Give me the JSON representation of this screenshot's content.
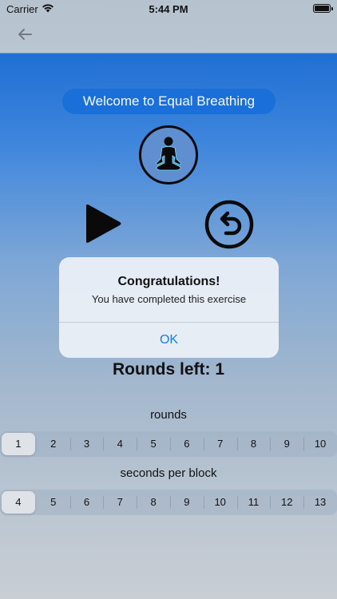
{
  "status_bar": {
    "carrier": "Carrier",
    "time": "5:44 PM"
  },
  "nav": {
    "back_icon": "arrow-left-icon"
  },
  "main": {
    "title": "Welcome to Equal Breathing",
    "meditation_icon": "meditation-person-icon",
    "play_icon": "play-icon",
    "reset_icon": "reset-arrow-icon",
    "rounds_left": "Rounds left: 1"
  },
  "alert": {
    "title": "Congratulations!",
    "message": "You have completed this exercise",
    "ok_label": "OK"
  },
  "rounds": {
    "label": "rounds",
    "options": [
      "1",
      "2",
      "3",
      "4",
      "5",
      "6",
      "7",
      "8",
      "9",
      "10"
    ],
    "selected": "1"
  },
  "seconds": {
    "label": "seconds per block",
    "options": [
      "4",
      "5",
      "6",
      "7",
      "8",
      "9",
      "10",
      "11",
      "12",
      "13"
    ],
    "selected": "4"
  },
  "colors": {
    "accent": "#1a6fd8",
    "alert_button": "#1e7be0"
  }
}
